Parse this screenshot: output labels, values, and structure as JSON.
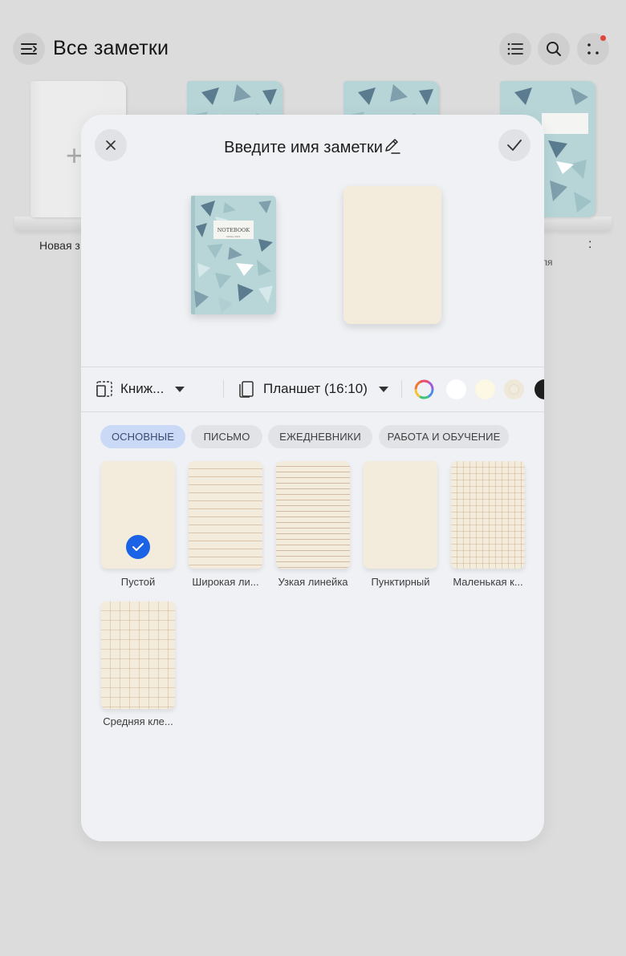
{
  "app": {
    "title": "Все заметки",
    "notebooks": [
      {
        "label": "Новая з"
      },
      {
        "label": "ля"
      },
      {
        "label": ":"
      }
    ]
  },
  "dialog": {
    "title": "Введите имя заметки",
    "cover": {
      "brand": "NOTEBOOK",
      "subtitle": "Notes 2021"
    },
    "options": {
      "orientation": "Книж...",
      "size": "Планшет (16:10)"
    },
    "colors": [
      "#ffffff",
      "#fdf8e4",
      "#f0ebdd",
      "#1e1e1e"
    ],
    "categories": [
      {
        "label": "ОСНОВНЫЕ",
        "active": true
      },
      {
        "label": "ПИСЬМО",
        "active": false
      },
      {
        "label": "ЕЖЕДНЕВНИКИ",
        "active": false
      },
      {
        "label": "РАБОТА И ОБУЧЕНИЕ",
        "active": false
      }
    ],
    "templates": [
      {
        "label": "Пустой",
        "selected": true
      },
      {
        "label": "Широкая ли..."
      },
      {
        "label": "Узкая линейка"
      },
      {
        "label": "Пунктирный"
      },
      {
        "label": "Маленькая к..."
      },
      {
        "label": "Средняя кле..."
      }
    ]
  },
  "theme": {
    "accent": "#1a63e6",
    "page_paper": "#f3ecdc",
    "chip_active_bg": "#c9d9f6"
  }
}
